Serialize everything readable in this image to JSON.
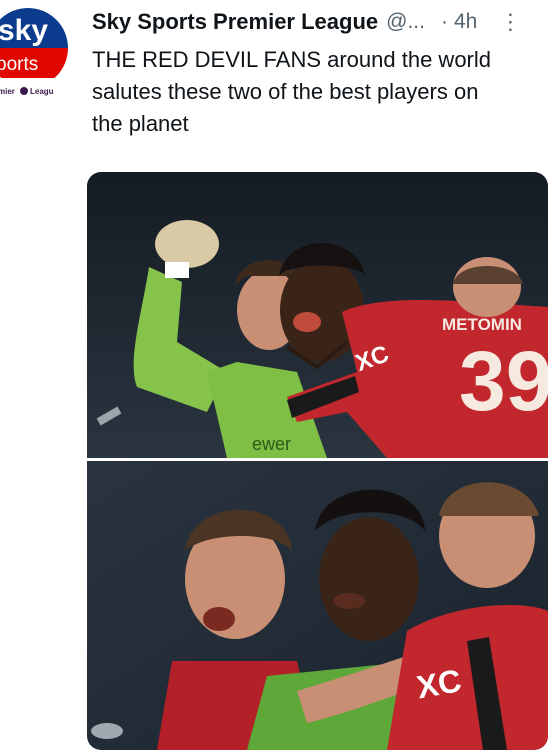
{
  "tweet": {
    "author_name": "Sky Sports Premier League",
    "handle": "@...",
    "separator": "·",
    "time": "4h",
    "more_icon": "more-dots",
    "text": "THE RED DEVIL FANS around the world salutes these two of the best players on the planet"
  },
  "avatar": {
    "logo_text_top": "sky",
    "logo_text_mid": "ports",
    "logo_text_bottom": "mier",
    "logo_text_bottom2": "Leagu",
    "colors": {
      "blue": "#0b3b8c",
      "red": "#e10600"
    }
  },
  "media": {
    "photos": [
      {
        "jersey_name": "METOMIN",
        "jersey_number": "39"
      },
      {
        "jersey_logo": "XC"
      }
    ]
  }
}
